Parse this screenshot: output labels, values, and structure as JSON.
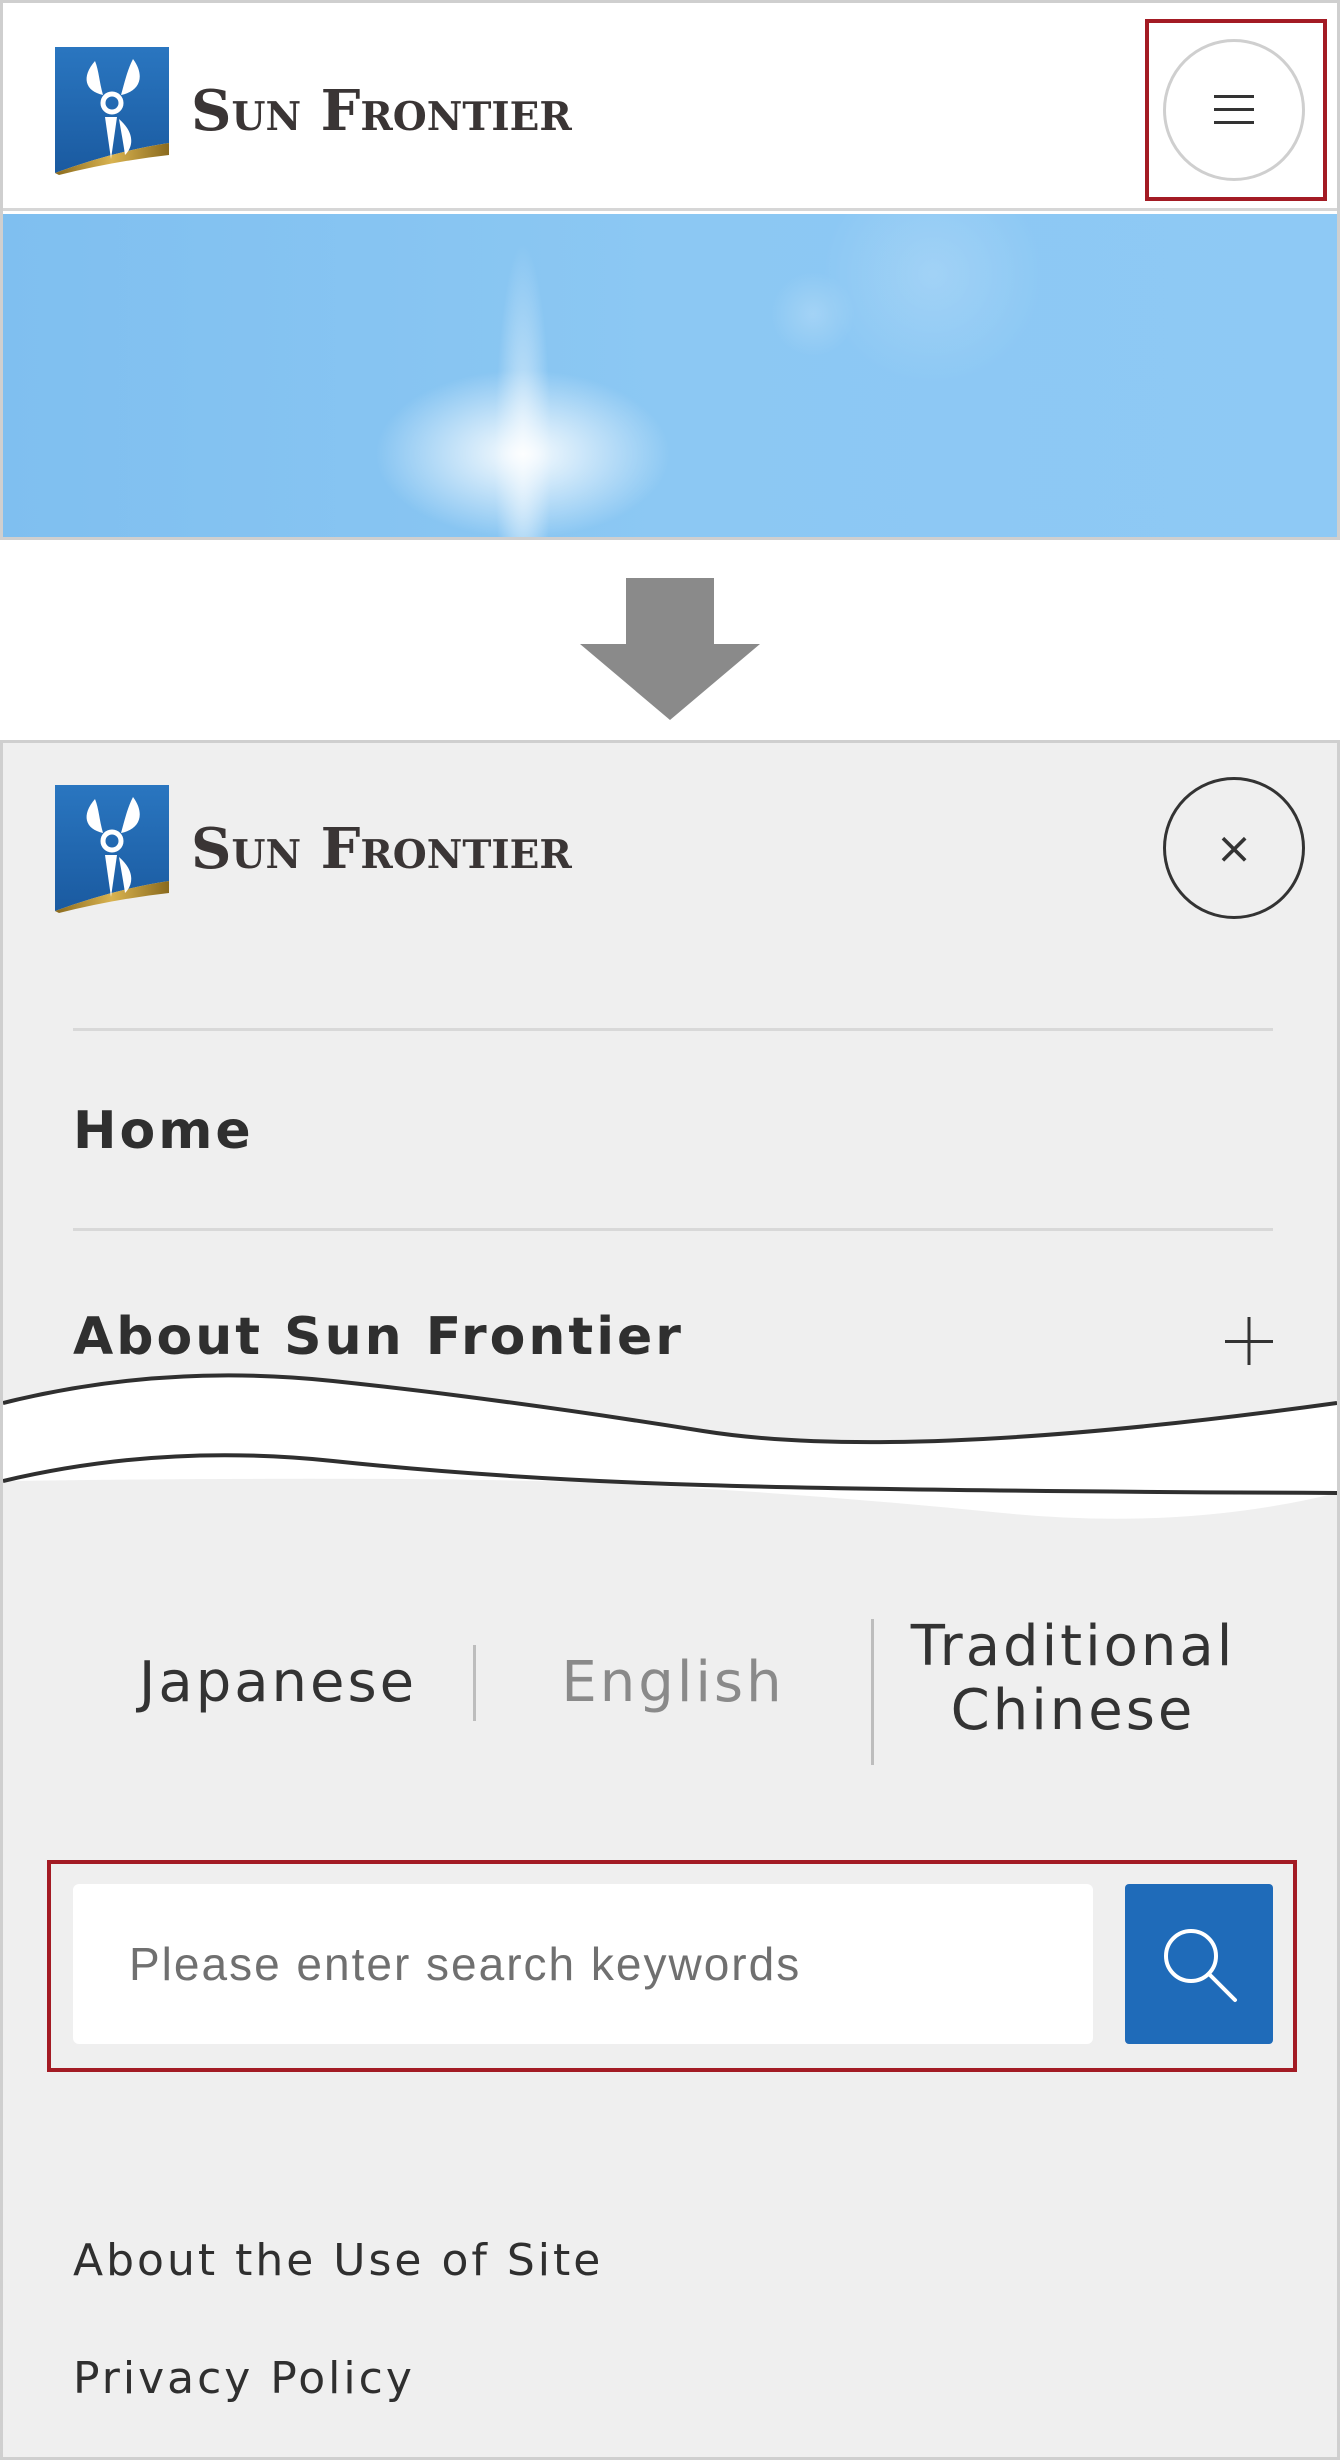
{
  "top_panel": {
    "brand": "Sun Frontier",
    "logo_icon": "sun-frontier-logo",
    "menu_icon": "hamburger-icon"
  },
  "menu_panel": {
    "brand": "Sun Frontier",
    "close_symbol": "×",
    "nav": [
      {
        "label": "Home"
      },
      {
        "label": "About Sun Frontier",
        "expand_icon": "plus-icon"
      }
    ],
    "languages": [
      {
        "label": "Japanese",
        "active": false
      },
      {
        "label": "English",
        "active": true
      },
      {
        "label": "Traditional Chinese",
        "active": false
      }
    ],
    "search": {
      "placeholder": "Please enter search keywords",
      "button_icon": "search-icon"
    },
    "footer_links": [
      {
        "label": "About the Use of Site"
      },
      {
        "label": "Privacy Policy"
      }
    ]
  },
  "colors": {
    "highlight_border": "#a31b24",
    "search_button": "#1f6bb9",
    "menu_background": "#efefef",
    "active_language": "#8a8a8a",
    "text": "#2f2f2f"
  }
}
